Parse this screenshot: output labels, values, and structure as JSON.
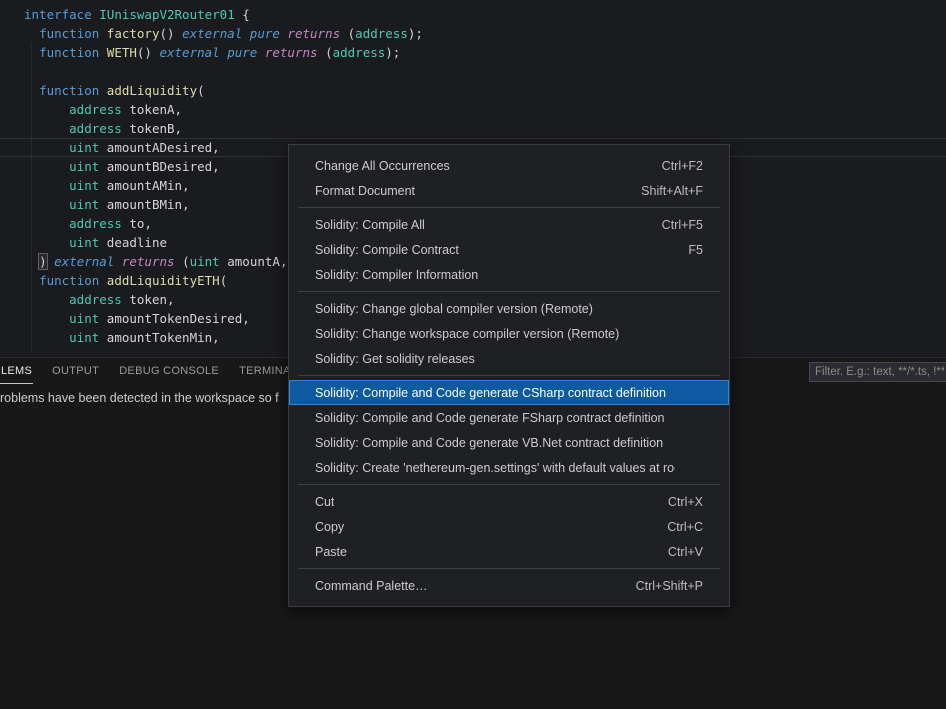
{
  "colors": {
    "menu_selection": "#0d5aa0",
    "menu_selection_border": "#2b86d8",
    "syntax": {
      "keyword": "#569cd6",
      "type": "#4ec9b0",
      "function": "#dcdcaa",
      "returns": "#c586c0",
      "identifier": "#d6d6d6",
      "punctuation": "#d4d4d4"
    }
  },
  "editor": {
    "language": "solidity",
    "code_lines": [
      {
        "tokens": [
          [
            "kw",
            "interface "
          ],
          [
            "typ",
            "IUniswapV2Router01"
          ],
          [
            "pun",
            " {"
          ]
        ]
      },
      {
        "tokens": [
          [
            "pun",
            "  "
          ],
          [
            "kw",
            "function "
          ],
          [
            "fn",
            "factory"
          ],
          [
            "pun",
            "() "
          ],
          [
            "kwi",
            "external pure "
          ],
          [
            "ret",
            "returns "
          ],
          [
            "pun",
            "("
          ],
          [
            "typ",
            "address"
          ],
          [
            "pun",
            ");"
          ]
        ]
      },
      {
        "tokens": [
          [
            "pun",
            "  "
          ],
          [
            "kw",
            "function "
          ],
          [
            "fn",
            "WETH"
          ],
          [
            "pun",
            "() "
          ],
          [
            "kwi",
            "external pure "
          ],
          [
            "ret",
            "returns "
          ],
          [
            "pun",
            "("
          ],
          [
            "typ",
            "address"
          ],
          [
            "pun",
            ");"
          ]
        ]
      },
      {
        "tokens": []
      },
      {
        "tokens": [
          [
            "pun",
            "  "
          ],
          [
            "kw",
            "function "
          ],
          [
            "fn",
            "addLiquidity"
          ],
          [
            "pun",
            "("
          ]
        ]
      },
      {
        "tokens": [
          [
            "pun",
            "      "
          ],
          [
            "typ",
            "address"
          ],
          [
            "id",
            " tokenA"
          ],
          [
            "pun",
            ","
          ]
        ]
      },
      {
        "tokens": [
          [
            "pun",
            "      "
          ],
          [
            "typ",
            "address"
          ],
          [
            "id",
            " tokenB"
          ],
          [
            "pun",
            ","
          ]
        ]
      },
      {
        "tokens": [
          [
            "pun",
            "      "
          ],
          [
            "typ",
            "uint"
          ],
          [
            "id",
            " amountADesired"
          ],
          [
            "pun",
            ","
          ]
        ],
        "current": true
      },
      {
        "tokens": [
          [
            "pun",
            "      "
          ],
          [
            "typ",
            "uint"
          ],
          [
            "id",
            " amountBDesired"
          ],
          [
            "pun",
            ","
          ]
        ]
      },
      {
        "tokens": [
          [
            "pun",
            "      "
          ],
          [
            "typ",
            "uint"
          ],
          [
            "id",
            " amountAMin"
          ],
          [
            "pun",
            ","
          ]
        ]
      },
      {
        "tokens": [
          [
            "pun",
            "      "
          ],
          [
            "typ",
            "uint"
          ],
          [
            "id",
            " amountBMin"
          ],
          [
            "pun",
            ","
          ]
        ]
      },
      {
        "tokens": [
          [
            "pun",
            "      "
          ],
          [
            "typ",
            "address"
          ],
          [
            "id",
            " to"
          ],
          [
            "pun",
            ","
          ]
        ]
      },
      {
        "tokens": [
          [
            "pun",
            "      "
          ],
          [
            "typ",
            "uint"
          ],
          [
            "id",
            " deadline"
          ]
        ]
      },
      {
        "tokens": [
          [
            "pun",
            "  "
          ],
          [
            "brk",
            ")"
          ],
          [
            "kwi",
            " external "
          ],
          [
            "ret",
            "returns "
          ],
          [
            "pun",
            "("
          ],
          [
            "typ",
            "uint"
          ],
          [
            "id",
            " amountA"
          ],
          [
            "pun",
            ","
          ]
        ]
      },
      {
        "tokens": [
          [
            "pun",
            "  "
          ],
          [
            "kw",
            "function "
          ],
          [
            "fn",
            "addLiquidityETH"
          ],
          [
            "pun",
            "("
          ]
        ]
      },
      {
        "tokens": [
          [
            "pun",
            "      "
          ],
          [
            "typ",
            "address"
          ],
          [
            "id",
            " token"
          ],
          [
            "pun",
            ","
          ]
        ]
      },
      {
        "tokens": [
          [
            "pun",
            "      "
          ],
          [
            "typ",
            "uint"
          ],
          [
            "id",
            " amountTokenDesired"
          ],
          [
            "pun",
            ","
          ]
        ]
      },
      {
        "tokens": [
          [
            "pun",
            "      "
          ],
          [
            "typ",
            "uint"
          ],
          [
            "id",
            " amountTokenMin"
          ],
          [
            "pun",
            ","
          ]
        ]
      }
    ]
  },
  "context_menu": {
    "groups": [
      {
        "items": [
          {
            "label": "Change All Occurrences",
            "shortcut": "Ctrl+F2"
          },
          {
            "label": "Format Document",
            "shortcut": "Shift+Alt+F"
          }
        ]
      },
      {
        "items": [
          {
            "label": "Solidity: Compile All",
            "shortcut": "Ctrl+F5"
          },
          {
            "label": "Solidity: Compile Contract",
            "shortcut": "F5"
          },
          {
            "label": "Solidity: Compiler Information",
            "shortcut": ""
          }
        ]
      },
      {
        "items": [
          {
            "label": "Solidity: Change global compiler version (Remote)",
            "shortcut": ""
          },
          {
            "label": "Solidity: Change workspace compiler version (Remote)",
            "shortcut": ""
          },
          {
            "label": "Solidity: Get solidity releases",
            "shortcut": ""
          }
        ]
      },
      {
        "items": [
          {
            "label": "Solidity: Compile and Code generate CSharp contract definition",
            "shortcut": "",
            "selected": true
          },
          {
            "label": "Solidity: Compile and Code generate FSharp contract definition",
            "shortcut": ""
          },
          {
            "label": "Solidity: Compile and Code generate VB.Net contract definition",
            "shortcut": ""
          },
          {
            "label": "Solidity: Create 'nethereum-gen.settings' with default values at root",
            "shortcut": ""
          }
        ]
      },
      {
        "items": [
          {
            "label": "Cut",
            "shortcut": "Ctrl+X"
          },
          {
            "label": "Copy",
            "shortcut": "Ctrl+C"
          },
          {
            "label": "Paste",
            "shortcut": "Ctrl+V"
          }
        ]
      },
      {
        "items": [
          {
            "label": "Command Palette…",
            "shortcut": "Ctrl+Shift+P"
          }
        ]
      }
    ]
  },
  "panel": {
    "tabs": [
      {
        "label": "LEMS",
        "active": true
      },
      {
        "label": "OUTPUT",
        "active": false
      },
      {
        "label": "DEBUG CONSOLE",
        "active": false
      },
      {
        "label": "TERMINAL",
        "active": false
      }
    ],
    "message": "roblems have been detected in the workspace so f",
    "filter_placeholder": "Filter. E.g.: text, **/*.ts, !**"
  }
}
